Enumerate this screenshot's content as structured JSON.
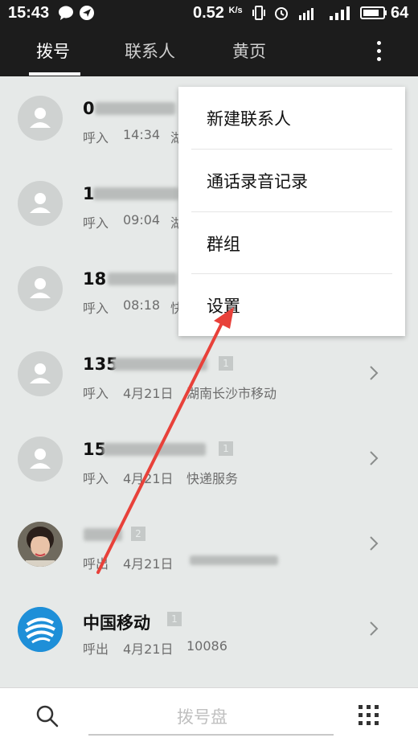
{
  "status_bar": {
    "time": "15:43",
    "net_speed": "0.52",
    "net_unit": "K/s",
    "battery": "64",
    "icons": [
      "message-icon",
      "send-icon",
      "vibrate-icon",
      "alarm-icon",
      "signal-4g-icon",
      "signal-icon",
      "battery-icon"
    ]
  },
  "tabs": [
    {
      "label": "拨号",
      "active": true
    },
    {
      "label": "联系人",
      "active": false
    },
    {
      "label": "黄页",
      "active": false
    }
  ],
  "calls": [
    {
      "name": "0",
      "direction": "呼入",
      "time": "14:34",
      "location": "湖",
      "badge": ""
    },
    {
      "name": "1",
      "direction": "呼入",
      "time": "09:04",
      "location": "湖",
      "badge": ""
    },
    {
      "name": "18",
      "direction": "呼入",
      "time": "08:18",
      "location": "快",
      "badge": ""
    },
    {
      "name": "135",
      "direction": "呼入",
      "time": "4月21日",
      "location": "湖南长沙市移动",
      "badge": "1"
    },
    {
      "name": "15",
      "direction": "呼入",
      "time": "4月21日",
      "location": "快递服务",
      "badge": "1"
    },
    {
      "name": "",
      "direction": "呼出",
      "time": "4月21日",
      "location": "",
      "badge": "2"
    },
    {
      "name": "中国移动",
      "direction": "呼出",
      "time": "4月21日",
      "location": "10086",
      "badge": "1"
    }
  ],
  "menu": {
    "items": [
      "新建联系人",
      "通话录音记录",
      "群组",
      "设置"
    ]
  },
  "bottom": {
    "dial_label": "拨号盘"
  },
  "colors": {
    "topbar": "#1c1c1c",
    "list_bg": "#e6e9e8",
    "annotation_arrow": "#e8413a",
    "china_mobile_blue": "#1e8fd8"
  }
}
